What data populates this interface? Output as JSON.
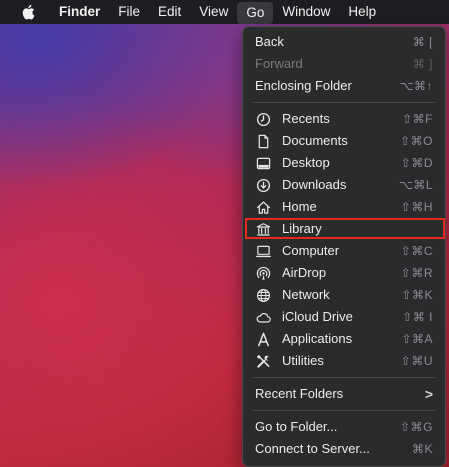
{
  "menubar": {
    "items": [
      "Finder",
      "File",
      "Edit",
      "View",
      "Go",
      "Window",
      "Help"
    ]
  },
  "go_menu": {
    "back": {
      "label": "Back",
      "shortcut": "⌘ ["
    },
    "forward": {
      "label": "Forward",
      "shortcut": "⌘ ]"
    },
    "enclosing": {
      "label": "Enclosing Folder",
      "shortcut": "⌥⌘↑"
    },
    "places": [
      {
        "label": "Recents",
        "shortcut": "⇧⌘F",
        "icon": "clock-icon"
      },
      {
        "label": "Documents",
        "shortcut": "⇧⌘O",
        "icon": "document-icon"
      },
      {
        "label": "Desktop",
        "shortcut": "⇧⌘D",
        "icon": "desktop-icon"
      },
      {
        "label": "Downloads",
        "shortcut": "⌥⌘L",
        "icon": "download-icon"
      },
      {
        "label": "Home",
        "shortcut": "⇧⌘H",
        "icon": "home-icon"
      },
      {
        "label": "Library",
        "shortcut": "",
        "icon": "library-icon"
      },
      {
        "label": "Computer",
        "shortcut": "⇧⌘C",
        "icon": "computer-icon"
      },
      {
        "label": "AirDrop",
        "shortcut": "⇧⌘R",
        "icon": "airdrop-icon"
      },
      {
        "label": "Network",
        "shortcut": "⇧⌘K",
        "icon": "network-icon"
      },
      {
        "label": "iCloud Drive",
        "shortcut": "⇧⌘ I",
        "icon": "cloud-icon"
      },
      {
        "label": "Applications",
        "shortcut": "⇧⌘A",
        "icon": "applications-icon"
      },
      {
        "label": "Utilities",
        "shortcut": "⇧⌘U",
        "icon": "utilities-icon"
      }
    ],
    "recent_folders": {
      "label": "Recent Folders",
      "shortcut": ">"
    },
    "go_to_folder": {
      "label": "Go to Folder...",
      "shortcut": "⇧⌘G"
    },
    "connect_server": {
      "label": "Connect to Server...",
      "shortcut": "⌘K"
    }
  },
  "colors": {
    "highlight_border": "#e8281f",
    "menu_bg": "#2b2b2d"
  }
}
